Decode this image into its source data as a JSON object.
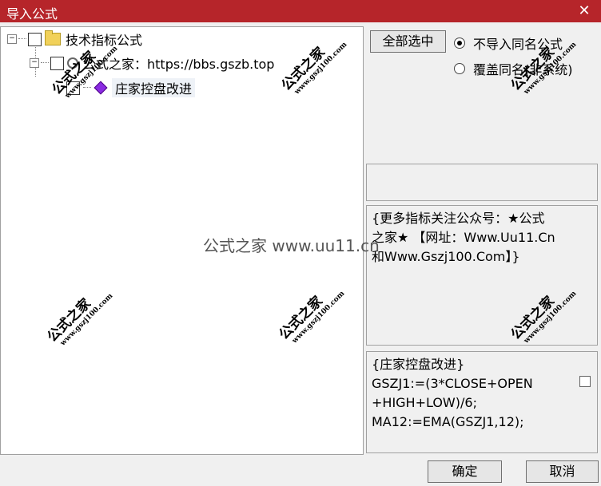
{
  "window": {
    "title": "导入公式",
    "close_label": "✕"
  },
  "tree": {
    "root_label": "技术指标公式",
    "expander_minus": "−",
    "child_label": "公式之家：https://bbs.gszb.top",
    "leaf_label": "庄家控盘改进"
  },
  "actions": {
    "select_all": "全部选中",
    "radio_no_import": "不导入同名公式",
    "radio_overwrite": "覆盖同名(非系统)",
    "ok": "确定",
    "cancel": "取消"
  },
  "description": {
    "line1": "{更多指标关注公众号：★公式",
    "line2": "之家★ 【网址：Www.Uu11.Cn",
    "line3": "和Www.Gszj100.Com】}"
  },
  "code": {
    "line1": "{庄家控盘改进}",
    "line2": "GSZJ1:=(3*CLOSE+OPEN",
    "line3": "+HIGH+LOW)/6;",
    "line4": "MA12:=EMA(GSZJ1,12);"
  },
  "watermark": {
    "big": "公式之家",
    "small": "www.gszj100.com",
    "center": "公式之家 www.uu11.cn"
  }
}
